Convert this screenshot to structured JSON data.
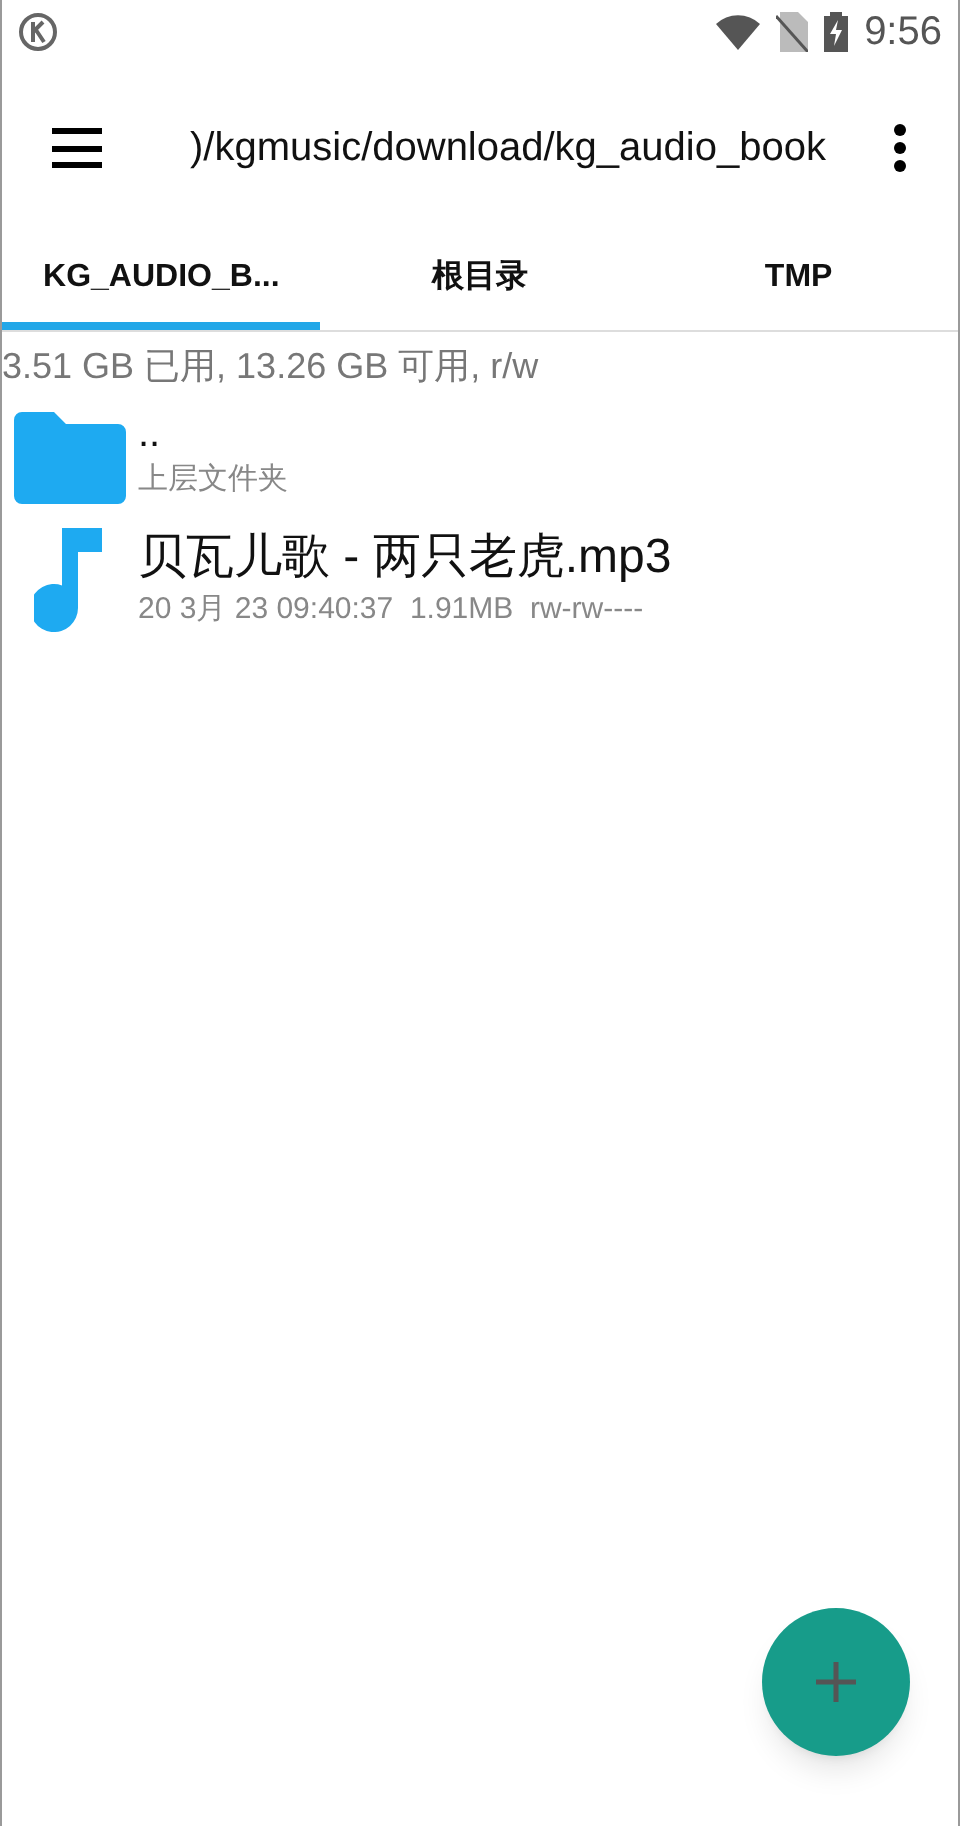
{
  "status_bar": {
    "time": "9:56"
  },
  "toolbar": {
    "path": ")/kgmusic/download/kg_audio_book"
  },
  "tabs": [
    {
      "label": "KG_AUDIO_B...",
      "selected": true
    },
    {
      "label": "根目录",
      "selected": false
    },
    {
      "label": "TMP",
      "selected": false
    }
  ],
  "storage": "3.51 GB 已用, 13.26 GB 可用, r/w",
  "files": [
    {
      "kind": "folder",
      "name": "..",
      "detail": "上层文件夹"
    },
    {
      "kind": "audio",
      "name": "贝瓦儿歌 - 两只老虎.mp3",
      "detail": "20 3月 23 09:40:37  1.91MB  rw-rw----"
    }
  ]
}
